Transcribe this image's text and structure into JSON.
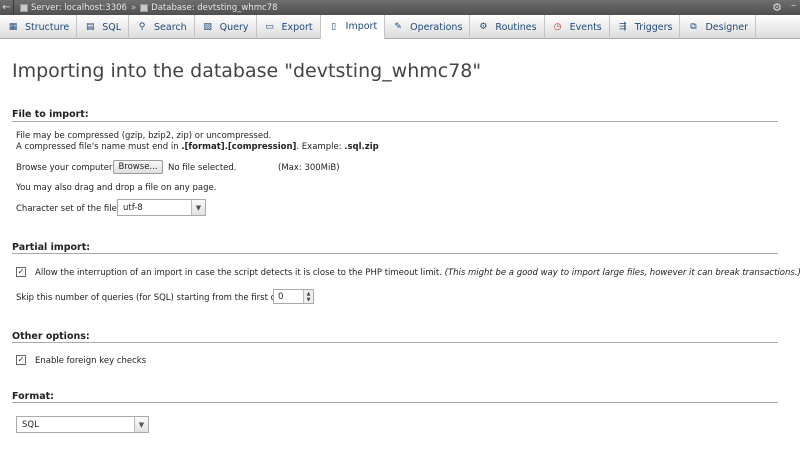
{
  "breadcrumb": {
    "server": "Server: localhost:3306",
    "separator": "»",
    "database": "Database: devtsting_whmc78"
  },
  "tabs": [
    {
      "label": "Structure",
      "icon": "structure-icon"
    },
    {
      "label": "SQL",
      "icon": "sql-icon"
    },
    {
      "label": "Search",
      "icon": "search-icon"
    },
    {
      "label": "Query",
      "icon": "query-icon"
    },
    {
      "label": "Export",
      "icon": "export-icon"
    },
    {
      "label": "Import",
      "icon": "import-icon",
      "active": true
    },
    {
      "label": "Operations",
      "icon": "wrench-icon"
    },
    {
      "label": "Routines",
      "icon": "routines-icon"
    },
    {
      "label": "Events",
      "icon": "clock-icon"
    },
    {
      "label": "Triggers",
      "icon": "triggers-icon"
    },
    {
      "label": "Designer",
      "icon": "designer-icon"
    }
  ],
  "page_title": "Importing into the database \"devtsting_whmc78\"",
  "file_import": {
    "title": "File to import:",
    "compress_note": "File may be compressed (gzip, bzip2, zip) or uncompressed.",
    "name_note_prefix": "A compressed file's name must end in ",
    "name_note_format": ".[format].[compression]",
    "name_note_mid": ". Example: ",
    "name_note_example": ".sql.zip",
    "browse_label": "Browse your computer:",
    "browse_button": "Browse...",
    "no_file": "No file selected.",
    "max": "(Max: 300MiB)",
    "drag_note": "You may also drag and drop a file on any page.",
    "charset_label": "Character set of the file:",
    "charset_value": "utf-8"
  },
  "partial_import": {
    "title": "Partial import:",
    "allow_label": "Allow the interruption of an import in case the script detects it is close to the PHP timeout limit.",
    "allow_note": "(This might be a good way to import large files, however it can break transactions.)",
    "allow_checked": true,
    "skip_label": "Skip this number of queries (for SQL) starting from the first one:",
    "skip_value": "0"
  },
  "other_options": {
    "title": "Other options:",
    "fk_label": "Enable foreign key checks",
    "fk_checked": true
  },
  "format": {
    "title": "Format:",
    "value": "SQL"
  }
}
